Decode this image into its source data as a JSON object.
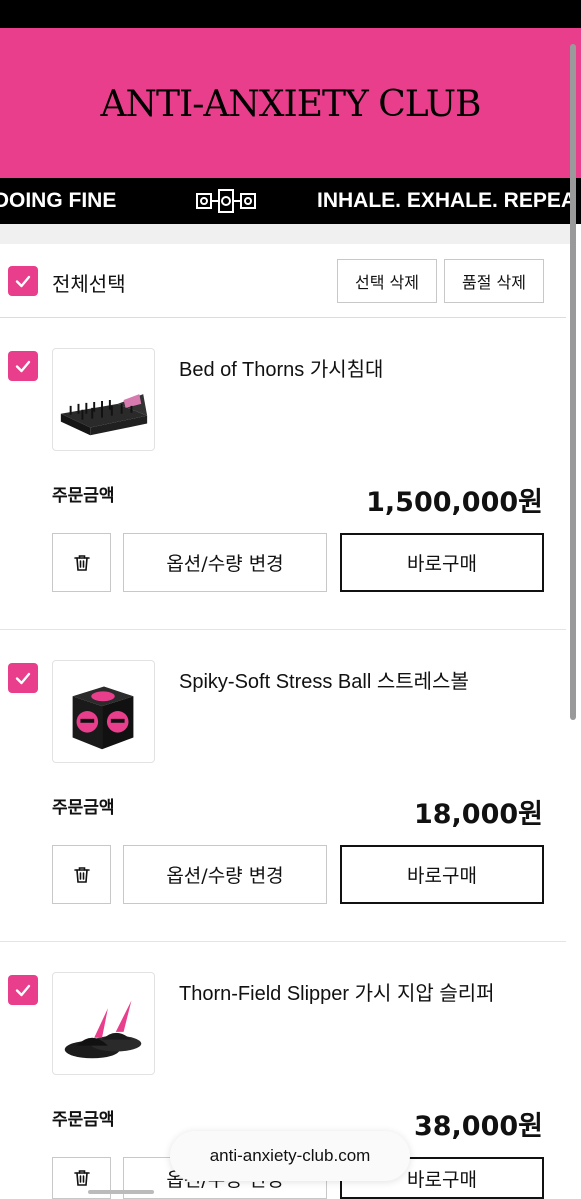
{
  "header": {
    "brand": "ANTI-ANXIETY CLUB"
  },
  "marquee": {
    "left_text": "E DOING FINE",
    "right_text": "INHALE. EXHALE. REPEA"
  },
  "cart": {
    "select_all_label": "전체선택",
    "delete_selected_label": "선택 삭제",
    "delete_soldout_label": "품절 삭제",
    "items": [
      {
        "name": "Bed of Thorns 가시침대",
        "price_label": "주문금액",
        "price": "1,500,000원",
        "option_label": "옵션/수량 변경",
        "buy_label": "바로구매",
        "checked": true,
        "image_icon": "thorn-bed"
      },
      {
        "name": "Spiky-Soft Stress Ball 스트레스볼",
        "price_label": "주문금액",
        "price": "18,000원",
        "option_label": "옵션/수량 변경",
        "buy_label": "바로구매",
        "checked": true,
        "image_icon": "stress-cube"
      },
      {
        "name": "Thorn-Field Slipper 가시 지압 슬리퍼",
        "price_label": "주문금액",
        "price": "38,000원",
        "option_label": "옵션/수량 변경",
        "buy_label": "바로구매",
        "checked": true,
        "image_icon": "thorn-slipper"
      }
    ]
  },
  "browser": {
    "url": "anti-anxiety-club.com"
  },
  "colors": {
    "accent": "#e83e8c",
    "black": "#000000"
  }
}
